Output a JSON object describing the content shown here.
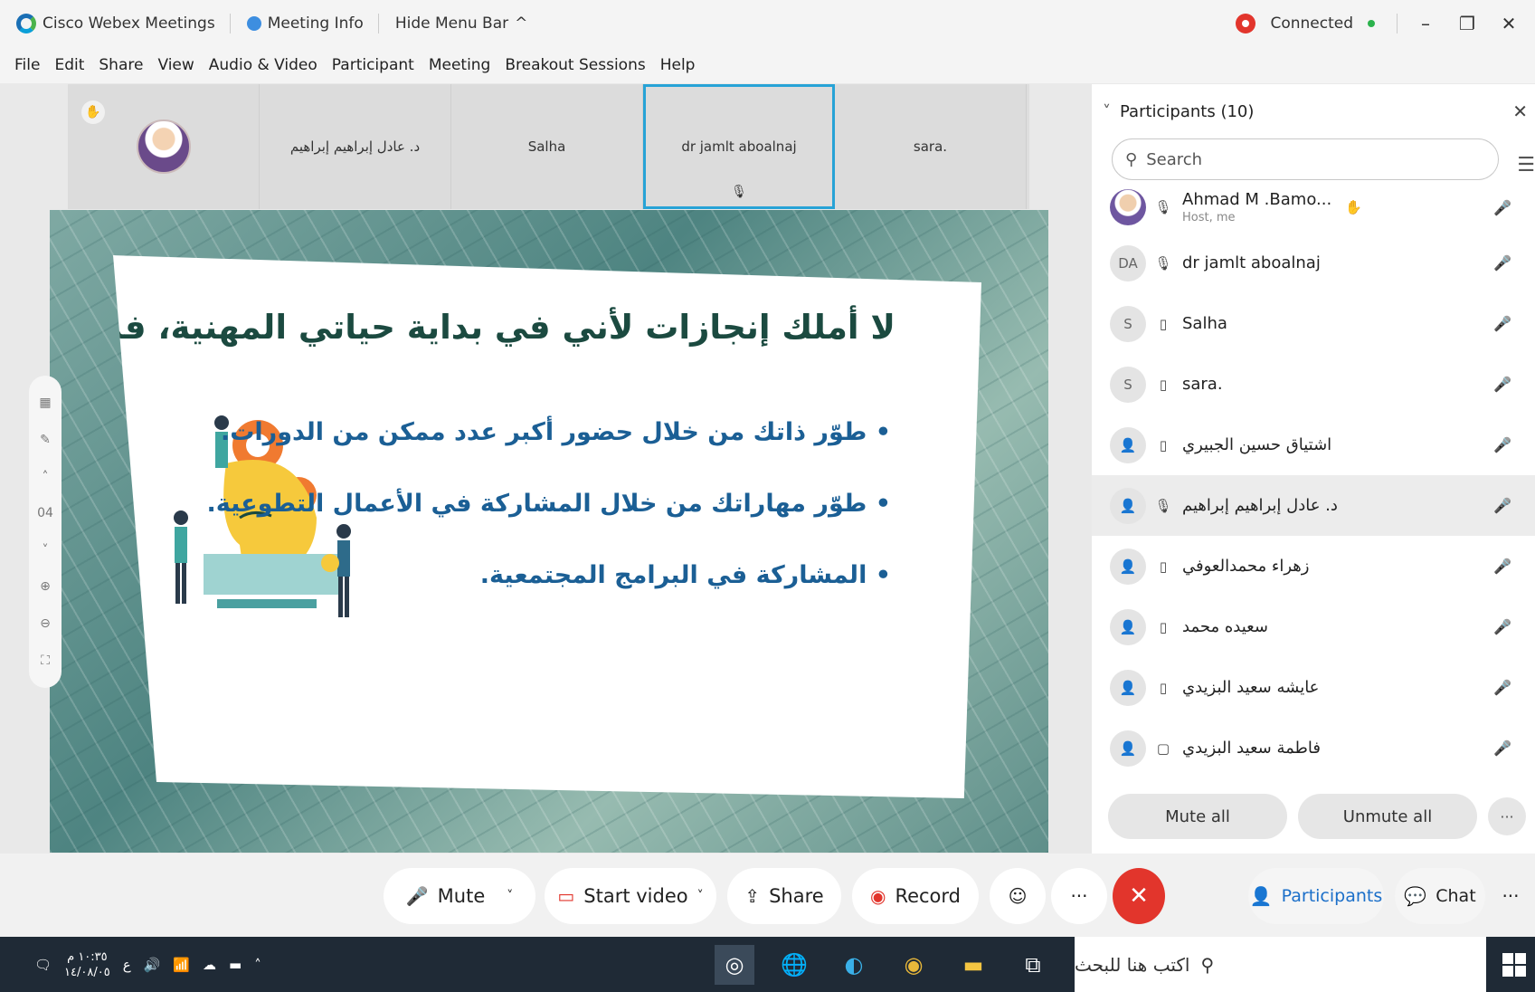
{
  "titlebar": {
    "app_name": "Cisco Webex Meetings",
    "meeting_info": "Meeting Info",
    "hide_menu_bar": "Hide Menu Bar",
    "status": "Connected",
    "icons": {
      "logo": "webex-logo",
      "info": "info-icon",
      "record": "recording-icon"
    }
  },
  "menubar": {
    "items": [
      "File",
      "Edit",
      "Share",
      "View",
      "Audio & Video",
      "Participant",
      "Meeting",
      "Breakout Sessions",
      "Help"
    ]
  },
  "filmstrip": {
    "tiles": [
      {
        "name": "",
        "type": "photo"
      },
      {
        "name": "د. عادل إبراهيم إبراهيم"
      },
      {
        "name": "Salha"
      },
      {
        "name": "dr jamlt aboalnaj",
        "active": true
      },
      {
        "name": "sara."
      }
    ]
  },
  "slide": {
    "title": "لا أملك إنجازات لأني في بداية حياتي المهنية، فما العمل؟",
    "bullets": [
      "طوّر ذاتك من خلال حضور أكبر عدد ممكن من الدورات.",
      "طوّر مهاراتك من خلال المشاركة في الأعمال التطوعية.",
      "المشاركة في البرامج المجتمعية."
    ],
    "colors": {
      "title": "#1b4a40",
      "bullets": "#1b5f95"
    }
  },
  "side_tools": {
    "page": "04"
  },
  "participants_panel": {
    "title": "Participants (10)",
    "search_placeholder": "Search",
    "participants": [
      {
        "initials": "",
        "name": "Ahmad M .Bamo...",
        "sub": "Host, me",
        "mic": "on",
        "photo": true
      },
      {
        "initials": "DA",
        "name": "dr jamlt aboalnaj",
        "sub": "",
        "mic": "on"
      },
      {
        "initials": "S",
        "name": "Salha",
        "sub": "",
        "mic": "off"
      },
      {
        "initials": "S",
        "name": "sara.",
        "sub": "",
        "mic": "off"
      },
      {
        "initials": "",
        "name": "اشتياق حسين الجبيري",
        "sub": "",
        "mic": "off"
      },
      {
        "initials": "",
        "name": "د. عادل إبراهيم إبراهيم",
        "sub": "",
        "mic": "off",
        "highlight": true
      },
      {
        "initials": "",
        "name": "زهراء محمدالعوفي",
        "sub": "",
        "mic": "off"
      },
      {
        "initials": "",
        "name": "سعيده محمد",
        "sub": "",
        "mic": "off"
      },
      {
        "initials": "",
        "name": "عايشه سعيد البزيدي",
        "sub": "",
        "mic": "off"
      },
      {
        "initials": "",
        "name": "فاطمة سعيد البزيدي",
        "sub": "",
        "mic": "off"
      }
    ],
    "mute_all": "Mute all",
    "unmute_all": "Unmute all"
  },
  "controls": {
    "mute": "Mute",
    "start_video": "Start video",
    "share": "Share",
    "record": "Record",
    "participants": "Participants",
    "chat": "Chat"
  },
  "taskbar": {
    "time": "١٠:٣٥ م",
    "date": "١٤/٠٨/٠٥",
    "lang": "ع",
    "search_placeholder": "اكتب هنا للبحث"
  }
}
